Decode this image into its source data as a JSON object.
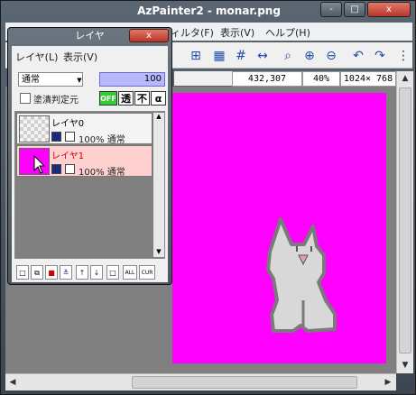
{
  "window": {
    "title": "AzPainter2 - monar.png",
    "buttons": {
      "min": "-",
      "max": "□",
      "close": "x"
    },
    "menu": [
      "ィルタ(F)",
      "表示(V)",
      "ヘルプ(H)"
    ],
    "toolbar_icons": [
      "move-icon",
      "checker-icon",
      "grid-icon",
      "fit-width-icon",
      "zoom-search-icon",
      "zoom-in-icon",
      "zoom-out-icon",
      "undo-icon",
      "redo-icon",
      "more-icon"
    ],
    "status": {
      "cursor": "432,307",
      "zoom": "40%",
      "size": "1024× 768"
    }
  },
  "layer_panel": {
    "title": "レイヤ",
    "close": "x",
    "menu": [
      "レイヤ(L)",
      "表示(V)"
    ],
    "blend_mode": "通常",
    "opacity": "100",
    "fill_check_label": "塗潰判定元",
    "mini_buttons": [
      "OFF",
      "透",
      "不",
      "α"
    ],
    "layers": [
      {
        "name": "レイヤ0",
        "info": "100% 通常",
        "selected": false,
        "thumb_color": "#d0d0d0"
      },
      {
        "name": "レイヤ1",
        "info": "100% 通常",
        "selected": true,
        "thumb_color": "#ff00ff"
      }
    ],
    "footer_buttons": [
      "new-layer-icon",
      "copy-layer-icon",
      "import-layer-icon",
      "merge-layer-icon",
      "move-up-icon",
      "move-down-icon",
      "blank-icon",
      "ALL",
      "CUR"
    ]
  },
  "colors": {
    "canvas": "#ff00ff",
    "selected_layer": "#ffd0d0",
    "accent": "#b8b8ff"
  }
}
